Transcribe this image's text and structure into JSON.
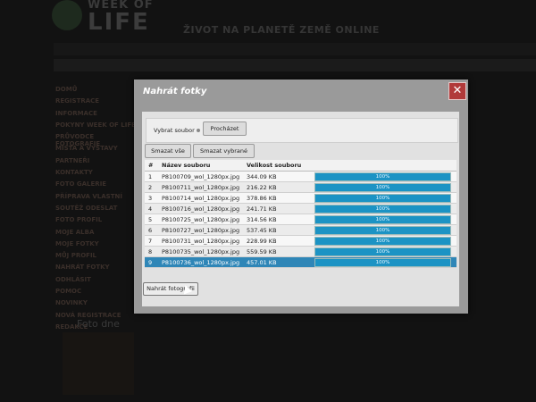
{
  "background": {
    "logo_top": "WEEK OF",
    "logo_main": "LIFE",
    "tagline": "ŽIVOT NA PLANETĚ ZEMĚ ONLINE",
    "menu": [
      "DOMŮ",
      "REGISTRACE",
      "INFORMACE",
      "POKYNY WEEK OF LIFE",
      "PRŮVODCE FOTOGRAFIE",
      "MÍSTA A VÝSTAVY",
      "PARTNEŘI",
      "KONTAKTY",
      "FOTO GALERIE",
      "PŘÍPRAVA VLASTNÍ",
      "SOUTĚŽ ODESLAT",
      "FOTO PROFIL",
      "MOJE ALBA",
      "MOJE FOTKY",
      "MŮJ PROFIL",
      "NAHRÁT FOTKY",
      "ODHLÁSIT",
      "POMOC",
      "NOVINKY",
      "NOVÁ REGISTRACE",
      "REDAKCE"
    ],
    "foto_label": "Foto dne"
  },
  "dialog": {
    "title": "Nahrát fotky",
    "close_symbol": "✕",
    "select_label": "Vybrat soubor",
    "browse_label": "Procházet",
    "delete_all_label": "Smazat vše",
    "delete_selected_label": "Smazat vybrané",
    "columns": [
      "#",
      "Název souboru",
      "Velikost souboru"
    ],
    "files": [
      {
        "n": "1",
        "name": "P8100709_wol_1280px.jpg",
        "size": "344.09 KB",
        "progress": "100%"
      },
      {
        "n": "2",
        "name": "P8100711_wol_1280px.jpg",
        "size": "216.22 KB",
        "progress": "100%"
      },
      {
        "n": "3",
        "name": "P8100714_wol_1280px.jpg",
        "size": "378.86 KB",
        "progress": "100%"
      },
      {
        "n": "4",
        "name": "P8100716_wol_1280px.jpg",
        "size": "241.71 KB",
        "progress": "100%"
      },
      {
        "n": "5",
        "name": "P8100725_wol_1280px.jpg",
        "size": "314.56 KB",
        "progress": "100%"
      },
      {
        "n": "6",
        "name": "P8100727_wol_1280px.jpg",
        "size": "537.45 KB",
        "progress": "100%"
      },
      {
        "n": "7",
        "name": "P8100731_wol_1280px.jpg",
        "size": "228.99 KB",
        "progress": "100%"
      },
      {
        "n": "8",
        "name": "P8100735_wol_1280px.jpg",
        "size": "559.59 KB",
        "progress": "100%"
      },
      {
        "n": "9",
        "name": "P8100736_wol_1280px.jpg",
        "size": "457.01 KB",
        "progress": "100%"
      }
    ],
    "selected_row": 8,
    "upload_label": "Nahrát fotografii"
  },
  "colors": {
    "accent": "#2f86b7",
    "progress_fill": "#1c93c4",
    "close_button": "#b13a3a"
  }
}
